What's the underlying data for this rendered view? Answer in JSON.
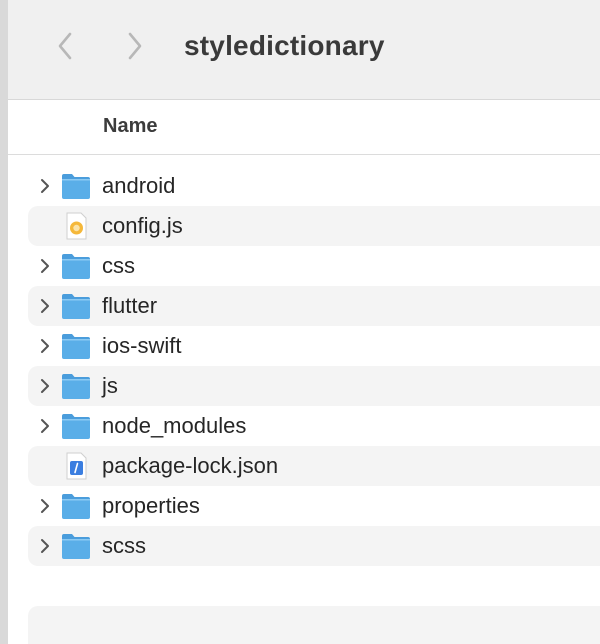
{
  "window": {
    "title": "styledictionary"
  },
  "toolbar": {
    "back_icon": "chevron-left-icon",
    "forward_icon": "chevron-right-icon"
  },
  "columns": {
    "name": "Name"
  },
  "files": [
    {
      "name": "android",
      "kind": "folder"
    },
    {
      "name": "config.js",
      "kind": "js-file"
    },
    {
      "name": "css",
      "kind": "folder"
    },
    {
      "name": "flutter",
      "kind": "folder"
    },
    {
      "name": "ios-swift",
      "kind": "folder"
    },
    {
      "name": "js",
      "kind": "folder"
    },
    {
      "name": "node_modules",
      "kind": "folder"
    },
    {
      "name": "package-lock.json",
      "kind": "json-file"
    },
    {
      "name": "properties",
      "kind": "folder"
    },
    {
      "name": "scss",
      "kind": "folder"
    }
  ],
  "colors": {
    "folder": "#5aaee8",
    "folder_tab": "#4a9ddc",
    "toolbar_bg": "#f0f0f0",
    "alt_row": "#f4f4f4"
  }
}
